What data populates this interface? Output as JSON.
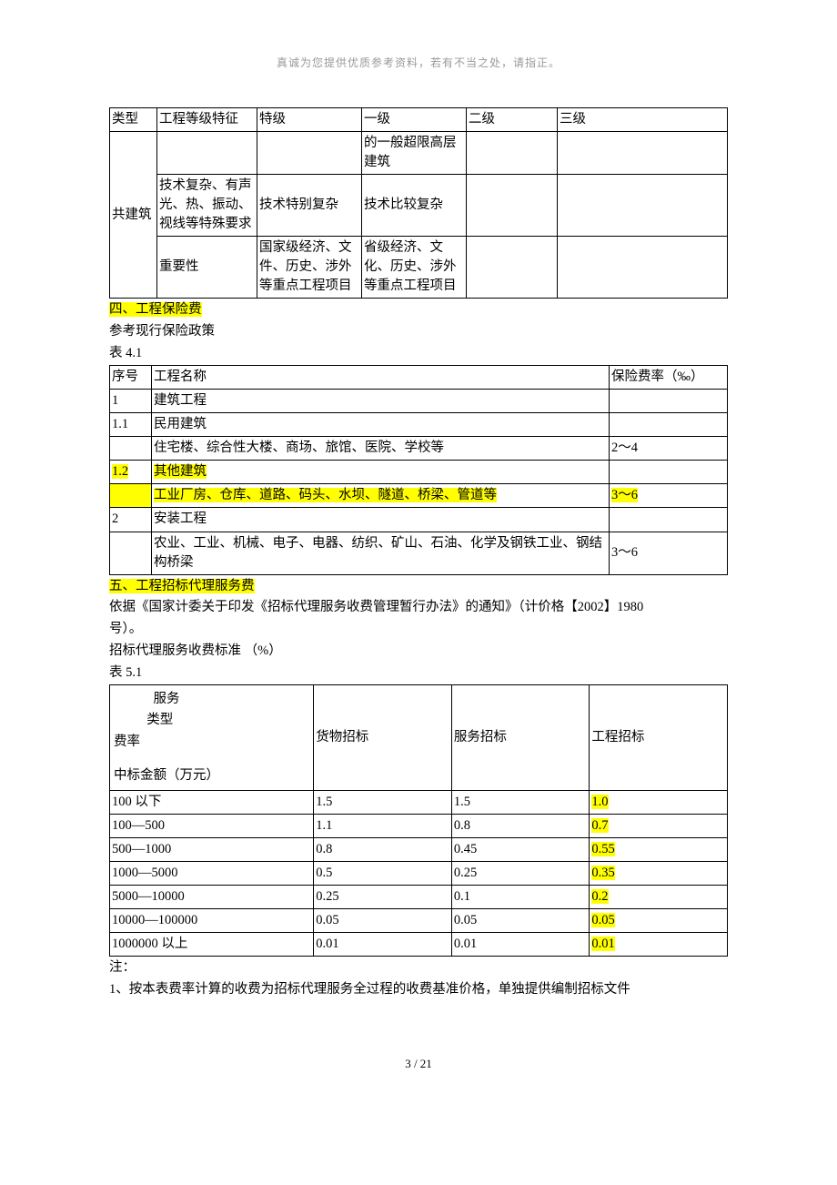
{
  "header_note": "真诚为您提供优质参考资料，若有不当之处，请指正。",
  "table1": {
    "r1": {
      "c1": "类型",
      "c2": "工程等级特征",
      "c3": "特级",
      "c4": "一级",
      "c5": "二级",
      "c6": "三级"
    },
    "r2": {
      "c1": "共建筑",
      "c4": "的一般超限高层建筑"
    },
    "r3": {
      "c2": "技术复杂、有声光、热、振动、视线等特殊要求",
      "c3": "技术特别复杂",
      "c4": "技术比较复杂"
    },
    "r4": {
      "c2": "重要性",
      "c3": "国家级经济、文件、历史、涉外等重点工程项目",
      "c4": "省级经济、文化、历史、涉外等重点工程项目"
    }
  },
  "sec4": {
    "title": "四、工程保险费",
    "line1": "参考现行保险政策",
    "tlabel": "表 4.1"
  },
  "table2": {
    "h": {
      "c1": "序号",
      "c2": "工程名称",
      "c3": "保险费率（‰）"
    },
    "r1": {
      "c1": "1",
      "c2": "建筑工程",
      "c3": ""
    },
    "r2": {
      "c1": "1.1",
      "c2": "民用建筑",
      "c3": ""
    },
    "r3": {
      "c1": "",
      "c2": "住宅楼、综合性大楼、商场、旅馆、医院、学校等",
      "c3": "2～4"
    },
    "r4": {
      "c1": "1.2",
      "c2": "其他建筑",
      "c3": ""
    },
    "r5": {
      "c1": "",
      "c2": "工业厂房、仓库、道路、码头、水坝、隧道、桥梁、管道等",
      "c3": "3～6"
    },
    "r6": {
      "c1": "2",
      "c2": "安装工程",
      "c3": ""
    },
    "r7": {
      "c1": "",
      "c2": "农业、工业、机械、电子、电器、纺织、矿山、石油、化学及钢铁工业、钢结构桥梁",
      "c3": "3～6"
    }
  },
  "sec5": {
    "title": "五、工程招标代理服务费",
    "line1a": "依据《国家计委关于印发《招标代理服务收费管理暂行办法》的通知》（计价格",
    "line1b": "【2002】1980",
    "line2": "号）。",
    "line3": "招标代理服务收费标准 （%）",
    "tlabel": "表 5.1"
  },
  "table3": {
    "h": {
      "label1": "服务",
      "label2": "类型",
      "rate": "费率",
      "bid": "中标金额（万元）",
      "c2": "货物招标",
      "c3": "服务招标",
      "c4": "工程招标"
    },
    "rows": [
      {
        "c1": "100 以下",
        "c2": "1.5",
        "c3": "1.5",
        "c4": "1.0"
      },
      {
        "c1": "100—500",
        "c2": "1.1",
        "c3": "0.8",
        "c4": "0.7"
      },
      {
        "c1": "500—1000",
        "c2": "0.8",
        "c3": "0.45",
        "c4": "0.55"
      },
      {
        "c1": "1000—5000",
        "c2": "0.5",
        "c3": "0.25",
        "c4": "0.35"
      },
      {
        "c1": "5000—10000",
        "c2": "0.25",
        "c3": "0.1",
        "c4": "0.2"
      },
      {
        "c1": "10000—100000",
        "c2": "0.05",
        "c3": "0.05",
        "c4": "0.05"
      },
      {
        "c1": "1000000 以上",
        "c2": "0.01",
        "c3": "0.01",
        "c4": "0.01"
      }
    ]
  },
  "notes": {
    "l1": "注：",
    "l2": "1、按本表费率计算的收费为招标代理服务全过程的收费基准价格，单独提供编制招标文件"
  },
  "footer": "3  /  21",
  "chart_data": [
    {
      "type": "table",
      "title": "表 4.1 工程保险费率",
      "columns": [
        "序号",
        "工程名称",
        "保险费率（‰）"
      ],
      "rows": [
        [
          "1",
          "建筑工程",
          ""
        ],
        [
          "1.1",
          "民用建筑",
          ""
        ],
        [
          "",
          "住宅楼、综合性大楼、商场、旅馆、医院、学校等",
          "2～4"
        ],
        [
          "1.2",
          "其他建筑",
          ""
        ],
        [
          "",
          "工业厂房、仓库、道路、码头、水坝、隧道、桥梁、管道等",
          "3～6"
        ],
        [
          "2",
          "安装工程",
          ""
        ],
        [
          "",
          "农业、工业、机械、电子、电器、纺织、矿山、石油、化学及钢铁工业、钢结构桥梁",
          "3～6"
        ]
      ]
    },
    {
      "type": "table",
      "title": "表 5.1 招标代理服务收费标准（%）",
      "columns": [
        "中标金额（万元）",
        "货物招标",
        "服务招标",
        "工程招标"
      ],
      "rows": [
        [
          "100 以下",
          1.5,
          1.5,
          1.0
        ],
        [
          "100—500",
          1.1,
          0.8,
          0.7
        ],
        [
          "500—1000",
          0.8,
          0.45,
          0.55
        ],
        [
          "1000—5000",
          0.5,
          0.25,
          0.35
        ],
        [
          "5000—10000",
          0.25,
          0.1,
          0.2
        ],
        [
          "10000—100000",
          0.05,
          0.05,
          0.05
        ],
        [
          "1000000 以上",
          0.01,
          0.01,
          0.01
        ]
      ]
    }
  ]
}
